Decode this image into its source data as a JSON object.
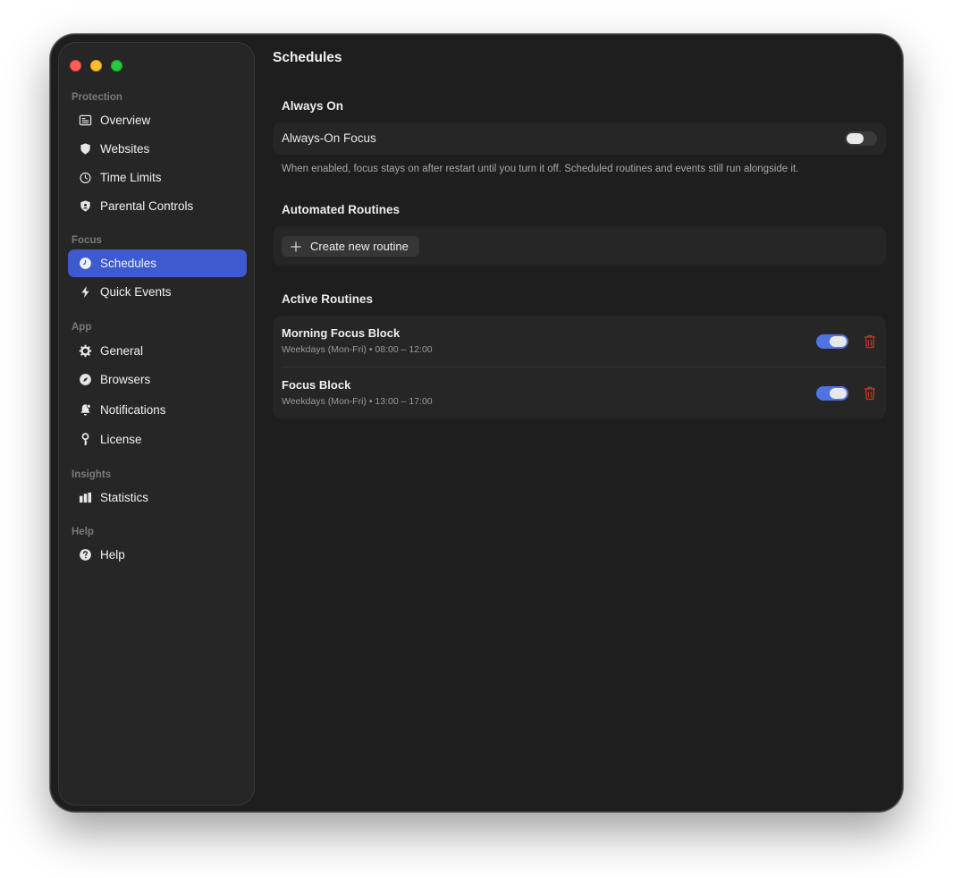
{
  "sidebar": {
    "sections": [
      {
        "title": "Protection",
        "items": [
          {
            "label": "Overview",
            "icon": "overview-icon"
          },
          {
            "label": "Websites",
            "icon": "shield-icon"
          },
          {
            "label": "Time Limits",
            "icon": "timer-icon"
          },
          {
            "label": "Parental Controls",
            "icon": "parental-shield-icon"
          }
        ]
      },
      {
        "title": "Focus",
        "items": [
          {
            "label": "Schedules",
            "icon": "clock-icon",
            "active": true
          },
          {
            "label": "Quick Events",
            "icon": "bolt-icon"
          }
        ]
      },
      {
        "title": "App",
        "items": [
          {
            "label": "General",
            "icon": "gear-icon"
          },
          {
            "label": "Browsers",
            "icon": "compass-icon"
          },
          {
            "label": "Notifications",
            "icon": "bell-icon"
          },
          {
            "label": "License",
            "icon": "key-icon"
          }
        ]
      },
      {
        "title": "Insights",
        "items": [
          {
            "label": "Statistics",
            "icon": "bar-chart-icon"
          }
        ]
      },
      {
        "title": "Help",
        "items": [
          {
            "label": "Help",
            "icon": "question-icon"
          }
        ]
      }
    ]
  },
  "main": {
    "title": "Schedules",
    "always_on": {
      "heading": "Always On",
      "label": "Always-On Focus",
      "enabled": false,
      "help": "When enabled, focus stays on after restart until you turn it off. Scheduled routines and events still run alongside it."
    },
    "automated": {
      "heading": "Automated Routines",
      "create_label": "Create new routine"
    },
    "active": {
      "heading": "Active Routines",
      "routines": [
        {
          "name": "Morning Focus Block",
          "schedule": "Weekdays (Mon-Fri) • 08:00 – 12:00",
          "enabled": true
        },
        {
          "name": "Focus Block",
          "schedule": "Weekdays (Mon-Fri) • 13:00 – 17:00",
          "enabled": true
        }
      ]
    }
  },
  "colors": {
    "accent": "#3d5bcf",
    "toggle_on": "#4f73e3",
    "delete": "#c0392b"
  }
}
